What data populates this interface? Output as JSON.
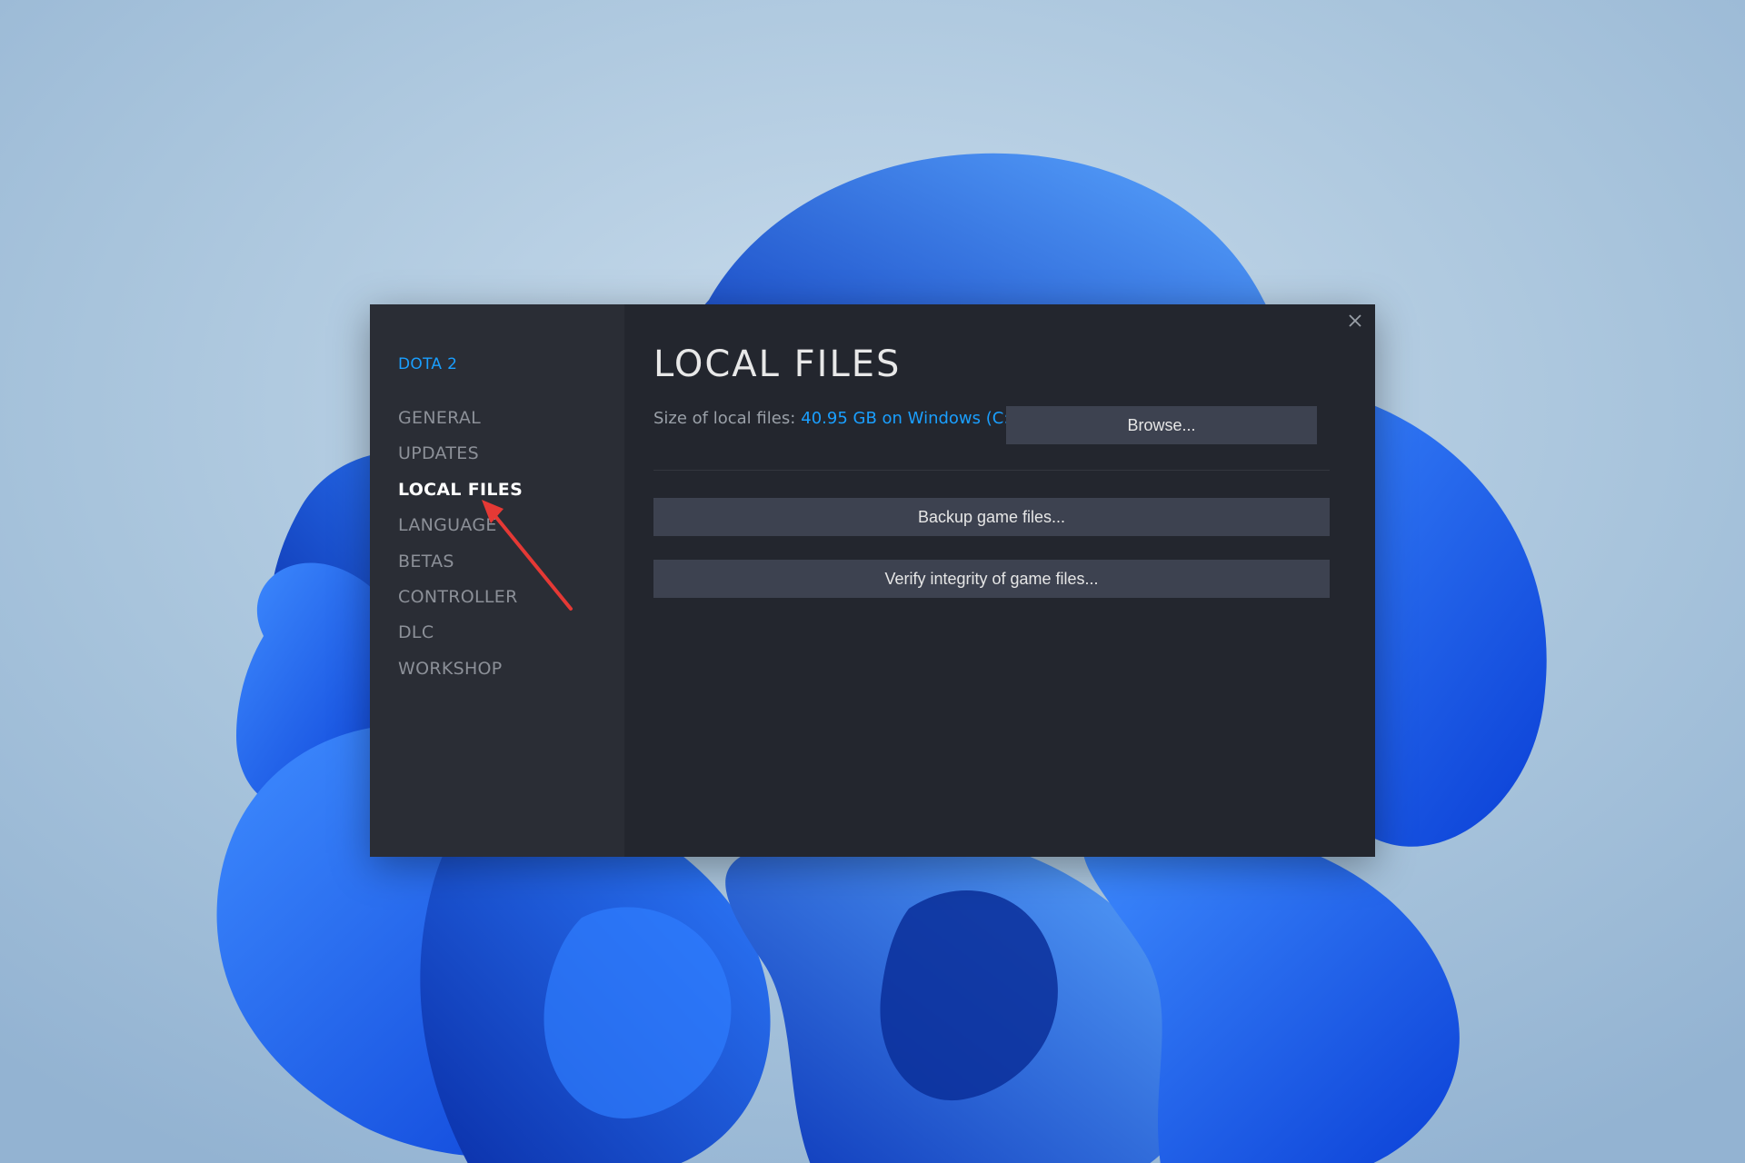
{
  "dialog": {
    "game_title": "DOTA 2",
    "page_title": "LOCAL FILES",
    "close_icon": "close-icon"
  },
  "sidebar": {
    "items": [
      {
        "label": "GENERAL",
        "active": false
      },
      {
        "label": "UPDATES",
        "active": false
      },
      {
        "label": "LOCAL FILES",
        "active": true
      },
      {
        "label": "LANGUAGE",
        "active": false
      },
      {
        "label": "BETAS",
        "active": false
      },
      {
        "label": "CONTROLLER",
        "active": false
      },
      {
        "label": "DLC",
        "active": false
      },
      {
        "label": "WORKSHOP",
        "active": false
      }
    ]
  },
  "local_files": {
    "size_label": "Size of local files:",
    "size_value": "40.95 GB on Windows (C:)",
    "browse_label": "Browse...",
    "backup_label": "Backup game files...",
    "verify_label": "Verify integrity of game files..."
  },
  "colors": {
    "accent": "#1a9fff",
    "dialog_bg": "#23262e",
    "sidebar_bg": "#2a2d35",
    "button_bg": "#3d4250",
    "annotation_arrow": "#e53935"
  }
}
